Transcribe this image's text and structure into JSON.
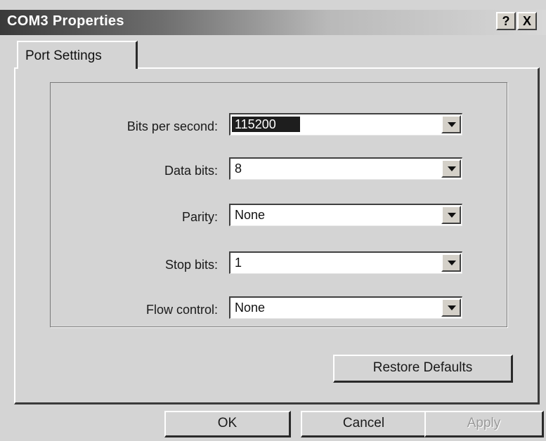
{
  "window": {
    "title": "COM3 Properties",
    "help_label": "?",
    "close_label": "X"
  },
  "tabs": [
    {
      "label": "Port Settings",
      "active": true
    }
  ],
  "settings": [
    {
      "label": "Bits per second:",
      "value": "115200"
    },
    {
      "label": "Data bits:",
      "value": "8"
    },
    {
      "label": "Parity:",
      "value": "None"
    },
    {
      "label": "Stop bits:",
      "value": "1"
    },
    {
      "label": "Flow control:",
      "value": "None"
    }
  ],
  "buttons": {
    "restore_defaults": "Restore Defaults",
    "ok": "OK",
    "cancel": "Cancel",
    "apply": "Apply"
  },
  "icons": {
    "dropdown": "chevron-down-icon",
    "help": "help-icon",
    "close": "close-icon"
  }
}
